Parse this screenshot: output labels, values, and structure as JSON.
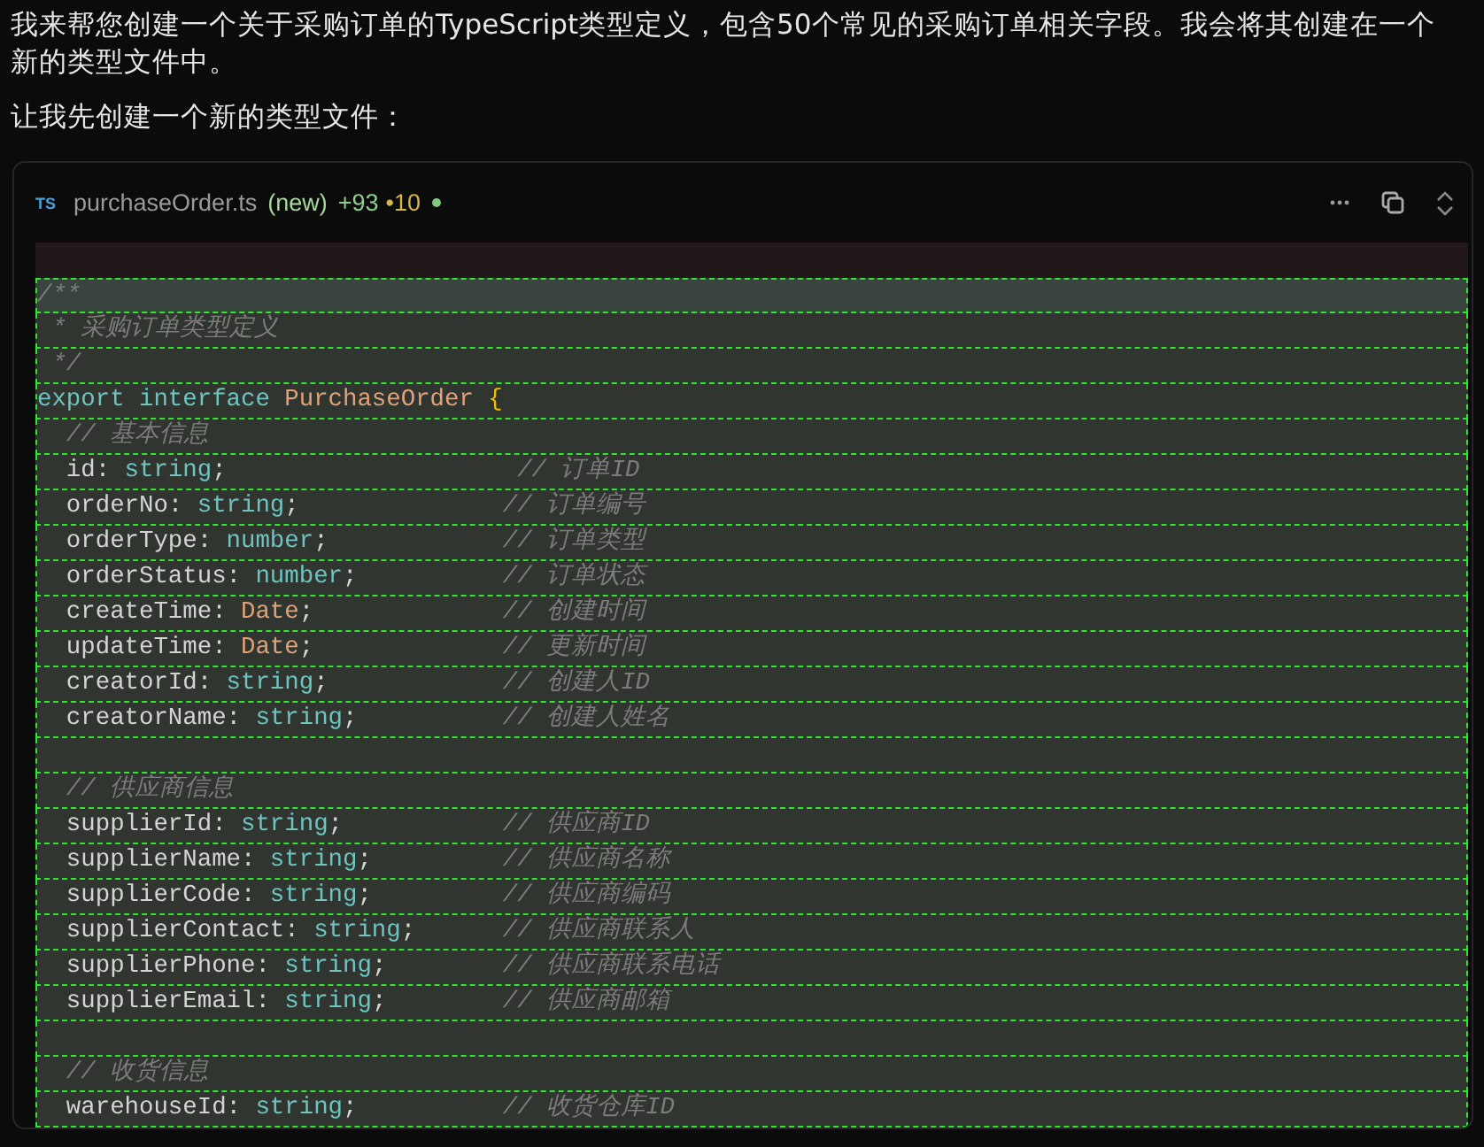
{
  "message": {
    "paragraphs": [
      "我来帮您创建一个关于采购订单的TypeScript类型定义，包含50个常见的采购订单相关字段。我会将其创建在一个新的类型文件中。",
      "让我先创建一个新的类型文件："
    ]
  },
  "file_card": {
    "lang_badge": "TS",
    "filename": "purchaseOrder.ts",
    "status": "(new)",
    "added": "+93",
    "removed": "•10",
    "unsaved": true,
    "lines": [
      {
        "kind": "removed"
      },
      {
        "kind": "added",
        "current": true,
        "tokens": [
          {
            "kind": "comment",
            "s": "/**"
          }
        ]
      },
      {
        "kind": "added",
        "current": false,
        "tokens": [
          {
            "kind": "comment",
            "s": " * 采购订单类型定义"
          }
        ]
      },
      {
        "kind": "added",
        "current": false,
        "tokens": [
          {
            "kind": "comment",
            "s": " */"
          }
        ]
      },
      {
        "kind": "added",
        "current": false,
        "tokens": [
          {
            "kind": "keyword",
            "s": "export interface "
          },
          {
            "kind": "typename",
            "s": "PurchaseOrder "
          },
          {
            "kind": "brace",
            "s": "{"
          }
        ]
      },
      {
        "kind": "added",
        "current": false,
        "tokens": [
          {
            "kind": "comment",
            "s": "  // 基本信息"
          }
        ]
      },
      {
        "kind": "added",
        "current": false,
        "tokens": [
          {
            "kind": "plain",
            "s": "  id: "
          },
          {
            "kind": "type",
            "s": "string"
          },
          {
            "kind": "plain",
            "s": ";                    "
          },
          {
            "kind": "comment",
            "s": "// 订单ID"
          }
        ]
      },
      {
        "kind": "added",
        "current": false,
        "tokens": [
          {
            "kind": "plain",
            "s": "  orderNo: "
          },
          {
            "kind": "type",
            "s": "string"
          },
          {
            "kind": "plain",
            "s": ";              "
          },
          {
            "kind": "comment",
            "s": "// 订单编号"
          }
        ]
      },
      {
        "kind": "added",
        "current": false,
        "tokens": [
          {
            "kind": "plain",
            "s": "  orderType: "
          },
          {
            "kind": "type",
            "s": "number"
          },
          {
            "kind": "plain",
            "s": ";            "
          },
          {
            "kind": "comment",
            "s": "// 订单类型"
          }
        ]
      },
      {
        "kind": "added",
        "current": false,
        "tokens": [
          {
            "kind": "plain",
            "s": "  orderStatus: "
          },
          {
            "kind": "type",
            "s": "number"
          },
          {
            "kind": "plain",
            "s": ";          "
          },
          {
            "kind": "comment",
            "s": "// 订单状态"
          }
        ]
      },
      {
        "kind": "added",
        "current": false,
        "tokens": [
          {
            "kind": "plain",
            "s": "  createTime: "
          },
          {
            "kind": "class",
            "s": "Date"
          },
          {
            "kind": "plain",
            "s": ";             "
          },
          {
            "kind": "comment",
            "s": "// 创建时间"
          }
        ]
      },
      {
        "kind": "added",
        "current": false,
        "tokens": [
          {
            "kind": "plain",
            "s": "  updateTime: "
          },
          {
            "kind": "class",
            "s": "Date"
          },
          {
            "kind": "plain",
            "s": ";             "
          },
          {
            "kind": "comment",
            "s": "// 更新时间"
          }
        ]
      },
      {
        "kind": "added",
        "current": false,
        "tokens": [
          {
            "kind": "plain",
            "s": "  creatorId: "
          },
          {
            "kind": "type",
            "s": "string"
          },
          {
            "kind": "plain",
            "s": ";            "
          },
          {
            "kind": "comment",
            "s": "// 创建人ID"
          }
        ]
      },
      {
        "kind": "added",
        "current": false,
        "tokens": [
          {
            "kind": "plain",
            "s": "  creatorName: "
          },
          {
            "kind": "type",
            "s": "string"
          },
          {
            "kind": "plain",
            "s": ";          "
          },
          {
            "kind": "comment",
            "s": "// 创建人姓名"
          }
        ]
      },
      {
        "kind": "added",
        "current": false
      },
      {
        "kind": "added",
        "current": false,
        "tokens": [
          {
            "kind": "comment",
            "s": "  // 供应商信息"
          }
        ]
      },
      {
        "kind": "added",
        "current": false,
        "tokens": [
          {
            "kind": "plain",
            "s": "  supplierId: "
          },
          {
            "kind": "type",
            "s": "string"
          },
          {
            "kind": "plain",
            "s": ";           "
          },
          {
            "kind": "comment",
            "s": "// 供应商ID"
          }
        ]
      },
      {
        "kind": "added",
        "current": false,
        "tokens": [
          {
            "kind": "plain",
            "s": "  supplierName: "
          },
          {
            "kind": "type",
            "s": "string"
          },
          {
            "kind": "plain",
            "s": ";         "
          },
          {
            "kind": "comment",
            "s": "// 供应商名称"
          }
        ]
      },
      {
        "kind": "added",
        "current": false,
        "tokens": [
          {
            "kind": "plain",
            "s": "  supplierCode: "
          },
          {
            "kind": "type",
            "s": "string"
          },
          {
            "kind": "plain",
            "s": ";         "
          },
          {
            "kind": "comment",
            "s": "// 供应商编码"
          }
        ]
      },
      {
        "kind": "added",
        "current": false,
        "tokens": [
          {
            "kind": "plain",
            "s": "  supplierContact: "
          },
          {
            "kind": "type",
            "s": "string"
          },
          {
            "kind": "plain",
            "s": ";      "
          },
          {
            "kind": "comment",
            "s": "// 供应商联系人"
          }
        ]
      },
      {
        "kind": "added",
        "current": false,
        "tokens": [
          {
            "kind": "plain",
            "s": "  supplierPhone: "
          },
          {
            "kind": "type",
            "s": "string"
          },
          {
            "kind": "plain",
            "s": ";        "
          },
          {
            "kind": "comment",
            "s": "// 供应商联系电话"
          }
        ]
      },
      {
        "kind": "added",
        "current": false,
        "tokens": [
          {
            "kind": "plain",
            "s": "  supplierEmail: "
          },
          {
            "kind": "type",
            "s": "string"
          },
          {
            "kind": "plain",
            "s": ";        "
          },
          {
            "kind": "comment",
            "s": "// 供应商邮箱"
          }
        ]
      },
      {
        "kind": "added",
        "current": false
      },
      {
        "kind": "added",
        "current": false,
        "tokens": [
          {
            "kind": "comment",
            "s": "  // 收货信息"
          }
        ]
      },
      {
        "kind": "added",
        "current": false,
        "tokens": [
          {
            "kind": "plain",
            "s": "  warehouseId: "
          },
          {
            "kind": "type",
            "s": "string"
          },
          {
            "kind": "plain",
            "s": ";          "
          },
          {
            "kind": "comment",
            "s": "// 收货仓库ID"
          }
        ]
      }
    ]
  }
}
